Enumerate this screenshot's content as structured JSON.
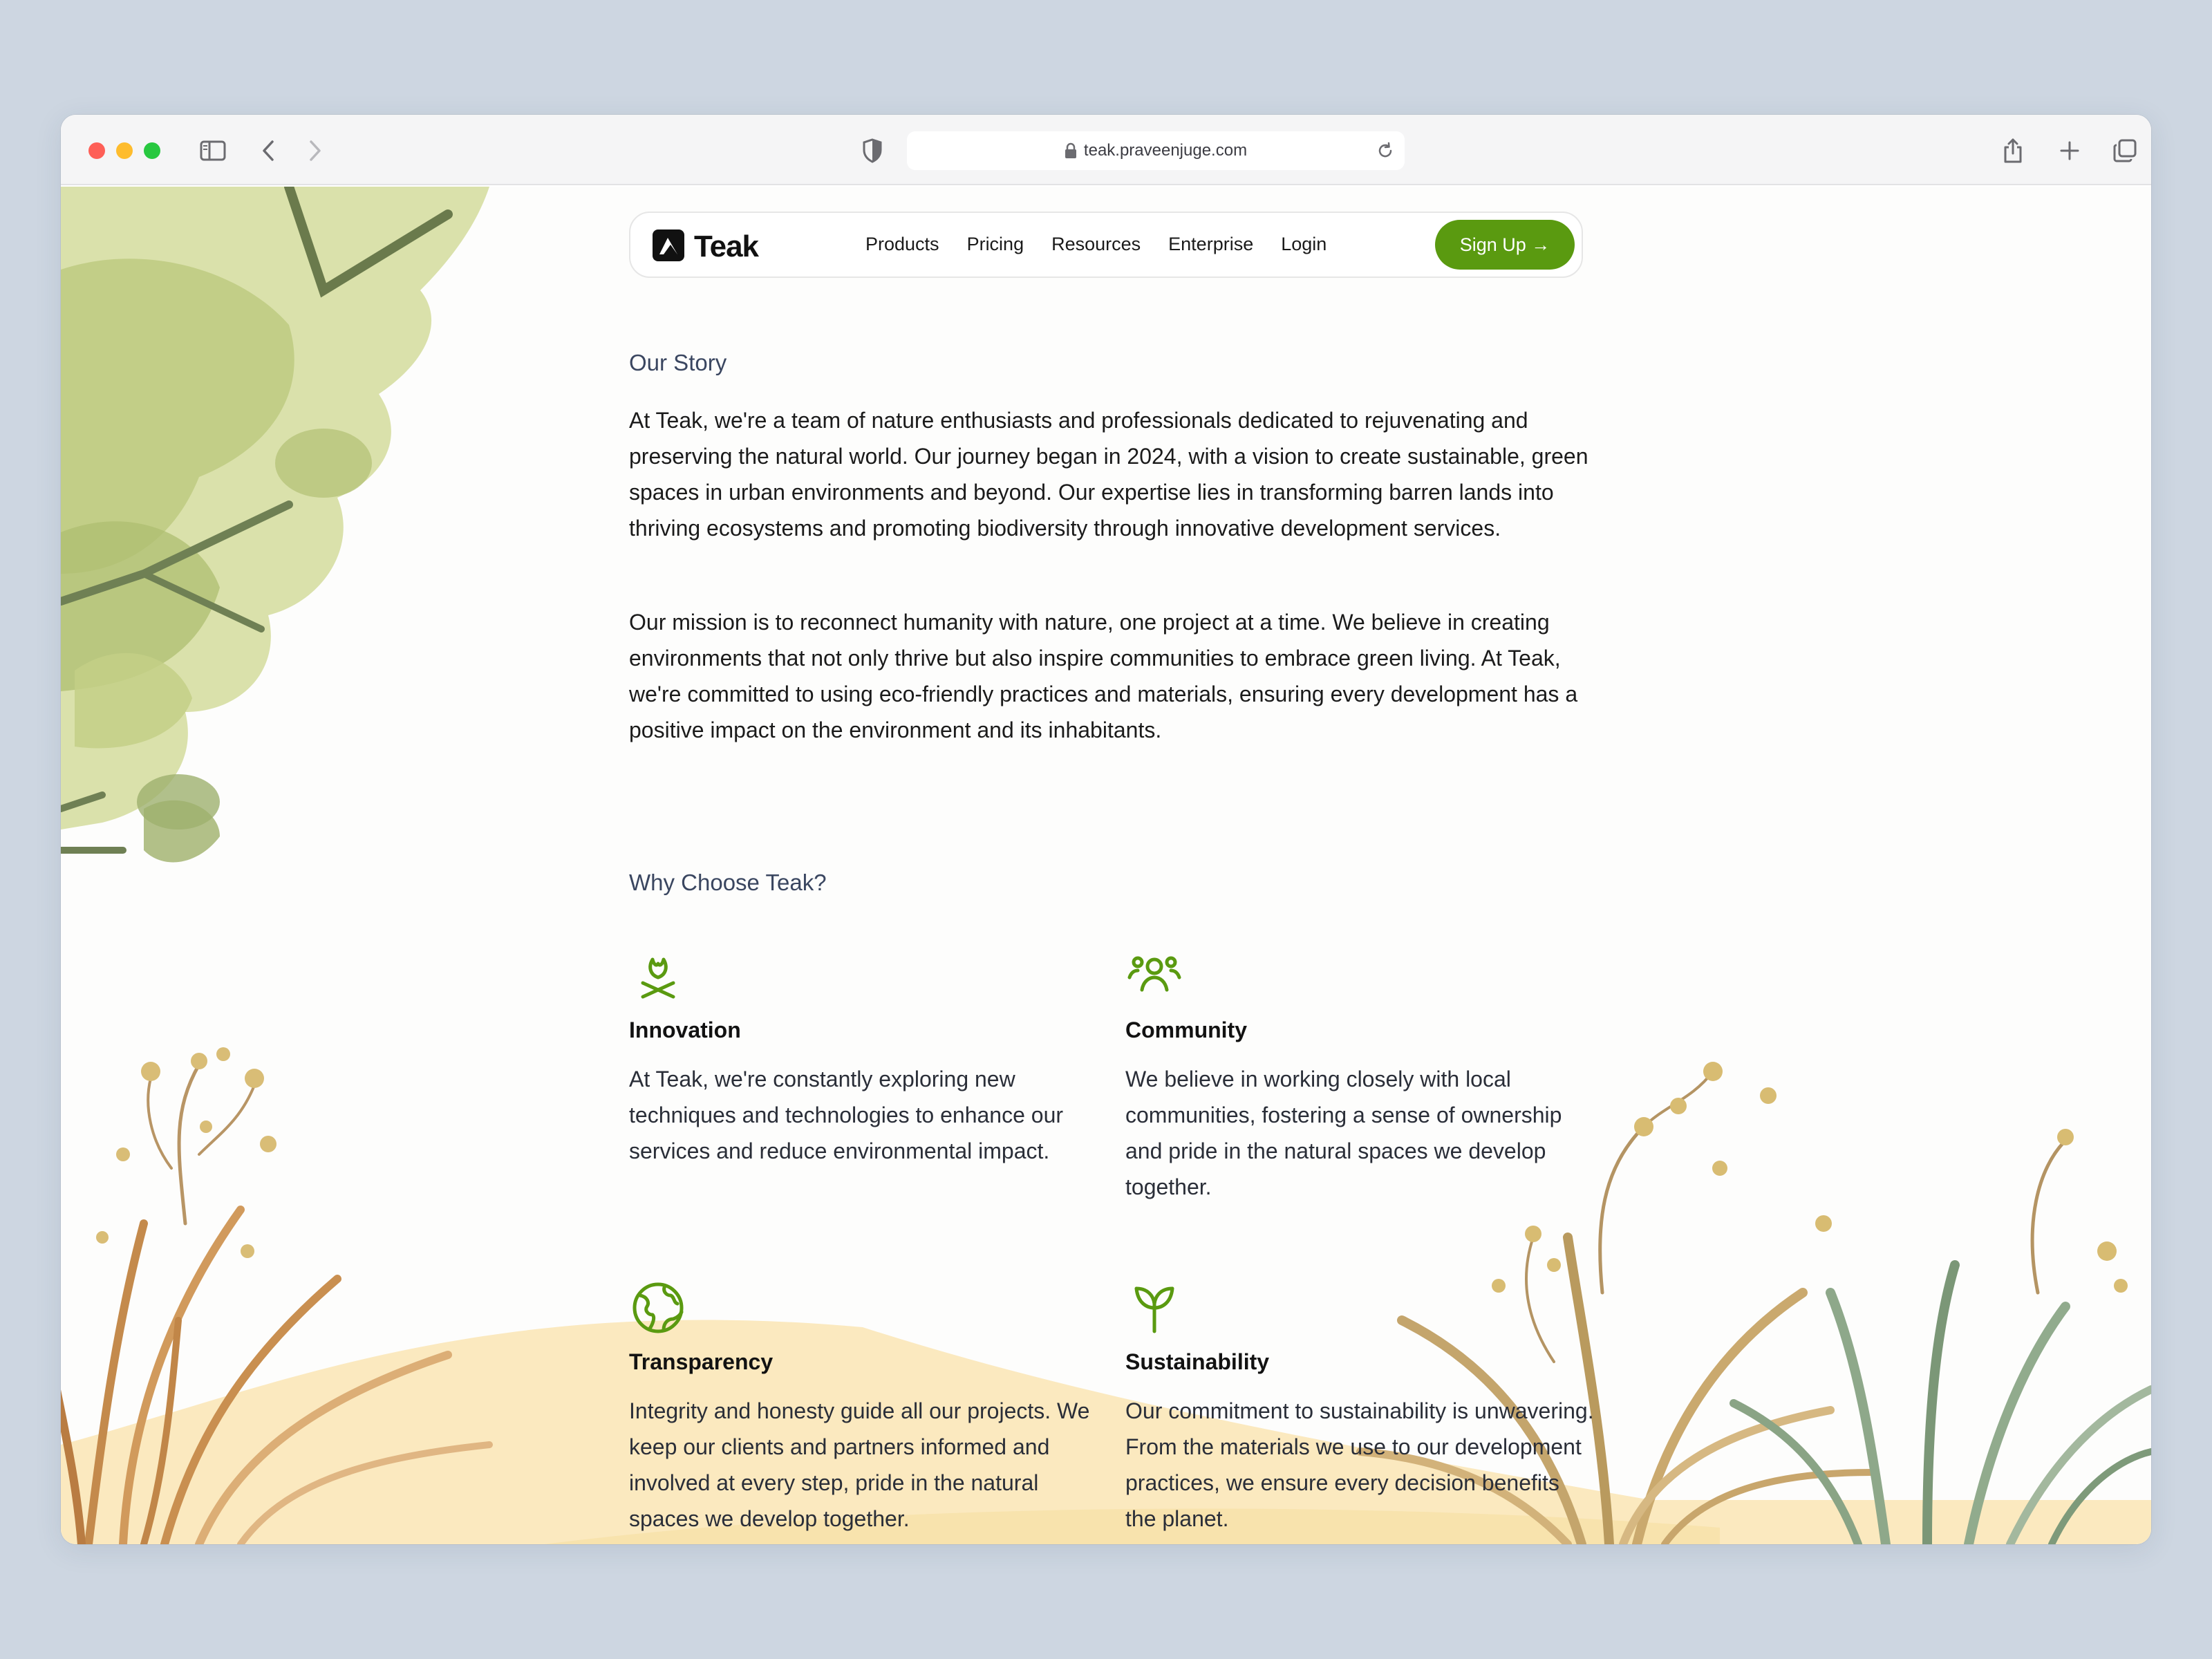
{
  "browser": {
    "url": "teak.praveenjuge.com"
  },
  "nav": {
    "brand": "Teak",
    "links": [
      "Products",
      "Pricing",
      "Resources",
      "Enterprise",
      "Login"
    ],
    "signup": "Sign Up →"
  },
  "story": {
    "title": "Our Story",
    "paragraphs": [
      "At Teak, we're a team of nature enthusiasts and professionals dedicated to rejuvenating and preserving the natural world. Our journey began in 2024, with a vision to create sustainable, green spaces in urban environments and beyond. Our expertise lies in transforming barren lands into thriving ecosystems and promoting biodiversity through innovative development services.",
      "Our mission is to reconnect humanity with nature, one project at a time. We believe in creating environments that not only thrive but also inspire communities to embrace green living. At Teak, we're committed to using eco-friendly practices and materials, ensuring every development has a positive impact on the environment and its inhabitants."
    ]
  },
  "why": {
    "title": "Why Choose Teak?",
    "features": [
      {
        "icon": "campfire-sprout-icon",
        "title": "Innovation",
        "text": "At Teak, we're constantly exploring new techniques and technologies to enhance our services and reduce environmental impact."
      },
      {
        "icon": "people-group-icon",
        "title": "Community",
        "text": "We believe in working closely with local communities, fostering a sense of ownership and pride in the natural spaces we develop together."
      },
      {
        "icon": "globe-icon",
        "title": "Transparency",
        "text": "Integrity and honesty guide all our projects. We keep our clients and partners informed and involved at every step, pride in the natural spaces we develop together."
      },
      {
        "icon": "sprout-icon",
        "title": "Sustainability",
        "text": "Our commitment to sustainability is unwavering. From the materials we use to our development practices, we ensure every decision benefits the planet."
      }
    ]
  },
  "colors": {
    "accent": "#5a9a10",
    "icon_green": "#5a9a10",
    "heading_slate": "#3a4660"
  }
}
